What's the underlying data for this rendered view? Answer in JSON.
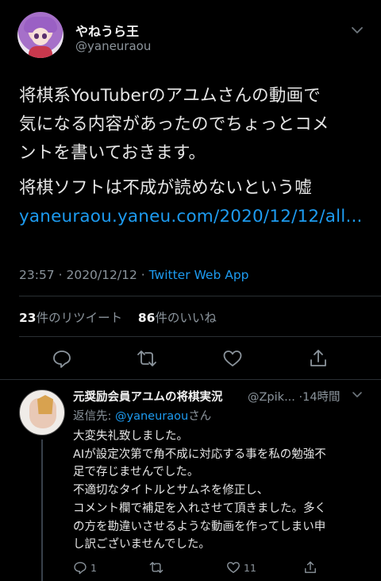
{
  "tweet": {
    "display_name": "やねうら王",
    "handle": "@yaneuraou",
    "text_lines": [
      "将棋系YouTuberのアユムさんの動画で",
      "気になる内容があったのでちょっとコメ",
      "ントを書いておきます。"
    ],
    "text_line2": "将棋ソフトは不成が読めないという嘘",
    "link": "yaneuraou.yaneu.com/2020/12/12/all...",
    "time": "23:57",
    "date": "2020/12/12",
    "separator": "·",
    "source": "Twitter Web App"
  },
  "stats": {
    "retweets": "23",
    "retweets_label": "件のリツイート",
    "likes": "86",
    "likes_label": "件のいいね"
  },
  "actions": {
    "icons": [
      "reply-icon",
      "retweet-icon",
      "like-icon",
      "share-icon"
    ]
  },
  "reply": {
    "display_name": "元奨励会員アユムの将棋実況",
    "handle": "@Zpik...",
    "separator": "·",
    "time": "14時間",
    "reply_to_prefix": "返信先: ",
    "reply_to_handle": "@yaneuraou",
    "reply_to_suffix": "さん",
    "text_lines": [
      "大変失礼致しました。",
      "AIが設定次第で角不成に対応する事を私の勉強不",
      "足で存じませんでした。",
      "不適切なタイトルとサムネを修正し、",
      "コメント欄で補足を入れさせて頂きました。多く",
      "の方を勘違いさせるような動画を作ってしまい申",
      "し訳ございませんでした。"
    ],
    "reply_count": "1",
    "like_count": "11"
  },
  "colors": {
    "background": "#000000",
    "link": "#1d9bf0",
    "secondary_text": "#8b949c"
  }
}
